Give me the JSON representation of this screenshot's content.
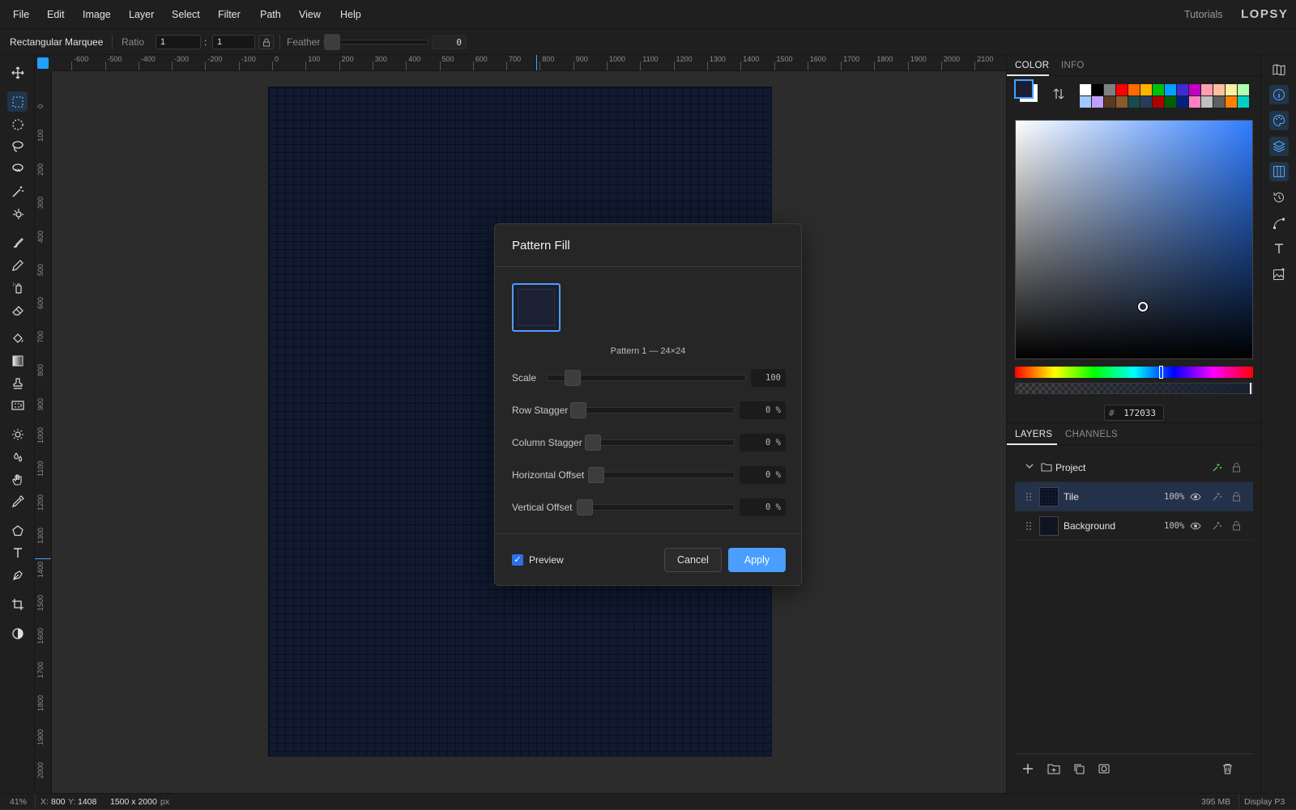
{
  "menubar": {
    "items": [
      "File",
      "Edit",
      "Image",
      "Layer",
      "Select",
      "Filter",
      "Path",
      "View",
      "Help"
    ],
    "tutorials": "Tutorials",
    "brand": "LOPSY"
  },
  "options": {
    "tool_name": "Rectangular Marquee",
    "ratio_label": "Ratio",
    "ratio_w": "1",
    "ratio_sep": ":",
    "ratio_h": "1",
    "feather_label": "Feather",
    "feather_value": "0"
  },
  "rulers": {
    "h": [
      "-600",
      "-500",
      "-400",
      "-300",
      "-200",
      "-100",
      "0",
      "100",
      "200",
      "300",
      "400",
      "500",
      "600",
      "700",
      "800",
      "900",
      "1000",
      "1100",
      "1200",
      "1300",
      "1400",
      "1500",
      "1600",
      "1700",
      "1800",
      "1900",
      "2000",
      "2100"
    ],
    "v": [
      "0",
      "100",
      "200",
      "300",
      "400",
      "500",
      "600",
      "700",
      "800",
      "900",
      "1000",
      "1100",
      "1200",
      "1300",
      "1400",
      "1500",
      "1600",
      "1700",
      "1800",
      "1900",
      "2000"
    ]
  },
  "dialog": {
    "title": "Pattern Fill",
    "pattern_caption": "Pattern 1 — 24×24",
    "rows": [
      {
        "label": "Scale",
        "value": "100"
      },
      {
        "label": "Row Stagger",
        "value": "0 %"
      },
      {
        "label": "Column Stagger",
        "value": "0 %"
      },
      {
        "label": "Horizontal Offset",
        "value": "0 %"
      },
      {
        "label": "Vertical Offset",
        "value": "0 %"
      }
    ],
    "preview_label": "Preview",
    "preview_checked": true,
    "cancel": "Cancel",
    "apply": "Apply"
  },
  "color_panel": {
    "tabs": [
      "COLOR",
      "INFO"
    ],
    "hex_prefix": "#",
    "hex": "172033",
    "foreground": "#172033",
    "palette_row1": [
      "#ffffff",
      "#000000",
      "#808080",
      "#ff0000",
      "#ff6a00",
      "#ffb300",
      "#00c000",
      "#00a0ff",
      "#3f2bd6",
      "#c000c0",
      "#ff9fb0",
      "#ffc0a0",
      "#ffefa0",
      "#b0ffb0"
    ],
    "palette_row2": [
      "#a0c8ff",
      "#c0a0ff",
      "#5a3a20",
      "#8a5a2a",
      "#1a4a4a",
      "#2a3a5a",
      "#b00000",
      "#006000",
      "#002080",
      "#ff80c0",
      "#c0c0c0",
      "#606060",
      "#ff8000",
      "#00d0c0"
    ]
  },
  "layers_panel": {
    "tabs": [
      "LAYERS",
      "CHANNELS"
    ],
    "group": {
      "name": "Project"
    },
    "layers": [
      {
        "name": "Tile",
        "opacity": "100%"
      },
      {
        "name": "Background",
        "opacity": "100%"
      }
    ]
  },
  "status": {
    "zoom": "41%",
    "x_label": "X:",
    "x": "800",
    "y_label": "Y:",
    "y": "1408",
    "doc_size": "1500 x 2000",
    "doc_unit": "px",
    "memory": "395 MB",
    "profile": "Display P3"
  }
}
